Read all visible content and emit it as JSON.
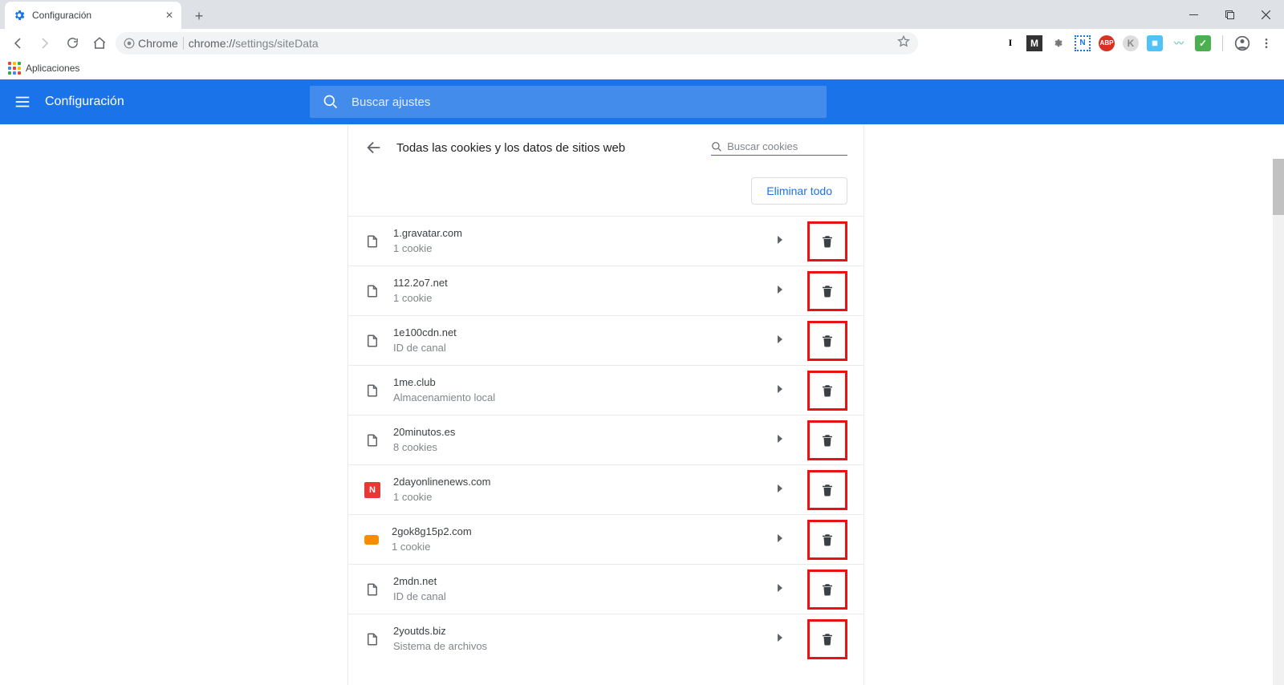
{
  "window": {
    "tab_title": "Configuración",
    "bookmark_apps": "Aplicaciones"
  },
  "omnibox": {
    "chip_label": "Chrome",
    "address_protocol": "chrome://",
    "address_path": "settings/siteData"
  },
  "header": {
    "app_title": "Configuración",
    "search_placeholder": "Buscar ajustes"
  },
  "page": {
    "title": "Todas las cookies y los datos de sitios web",
    "search_cookies_placeholder": "Buscar cookies",
    "clear_all_label": "Eliminar todo"
  },
  "sites": [
    {
      "domain": "1.gravatar.com",
      "detail": "1 cookie",
      "icon": "file"
    },
    {
      "domain": "112.2o7.net",
      "detail": "1 cookie",
      "icon": "file"
    },
    {
      "domain": "1e100cdn.net",
      "detail": "ID de canal",
      "icon": "file"
    },
    {
      "domain": "1me.club",
      "detail": "Almacenamiento local",
      "icon": "file"
    },
    {
      "domain": "20minutos.es",
      "detail": "8 cookies",
      "icon": "file"
    },
    {
      "domain": "2dayonlinenews.com",
      "detail": "1 cookie",
      "icon": "red"
    },
    {
      "domain": "2gok8g15p2.com",
      "detail": "1 cookie",
      "icon": "orange"
    },
    {
      "domain": "2mdn.net",
      "detail": "ID de canal",
      "icon": "file"
    },
    {
      "domain": "2youtds.biz",
      "detail": "Sistema de archivos",
      "icon": "file"
    }
  ]
}
